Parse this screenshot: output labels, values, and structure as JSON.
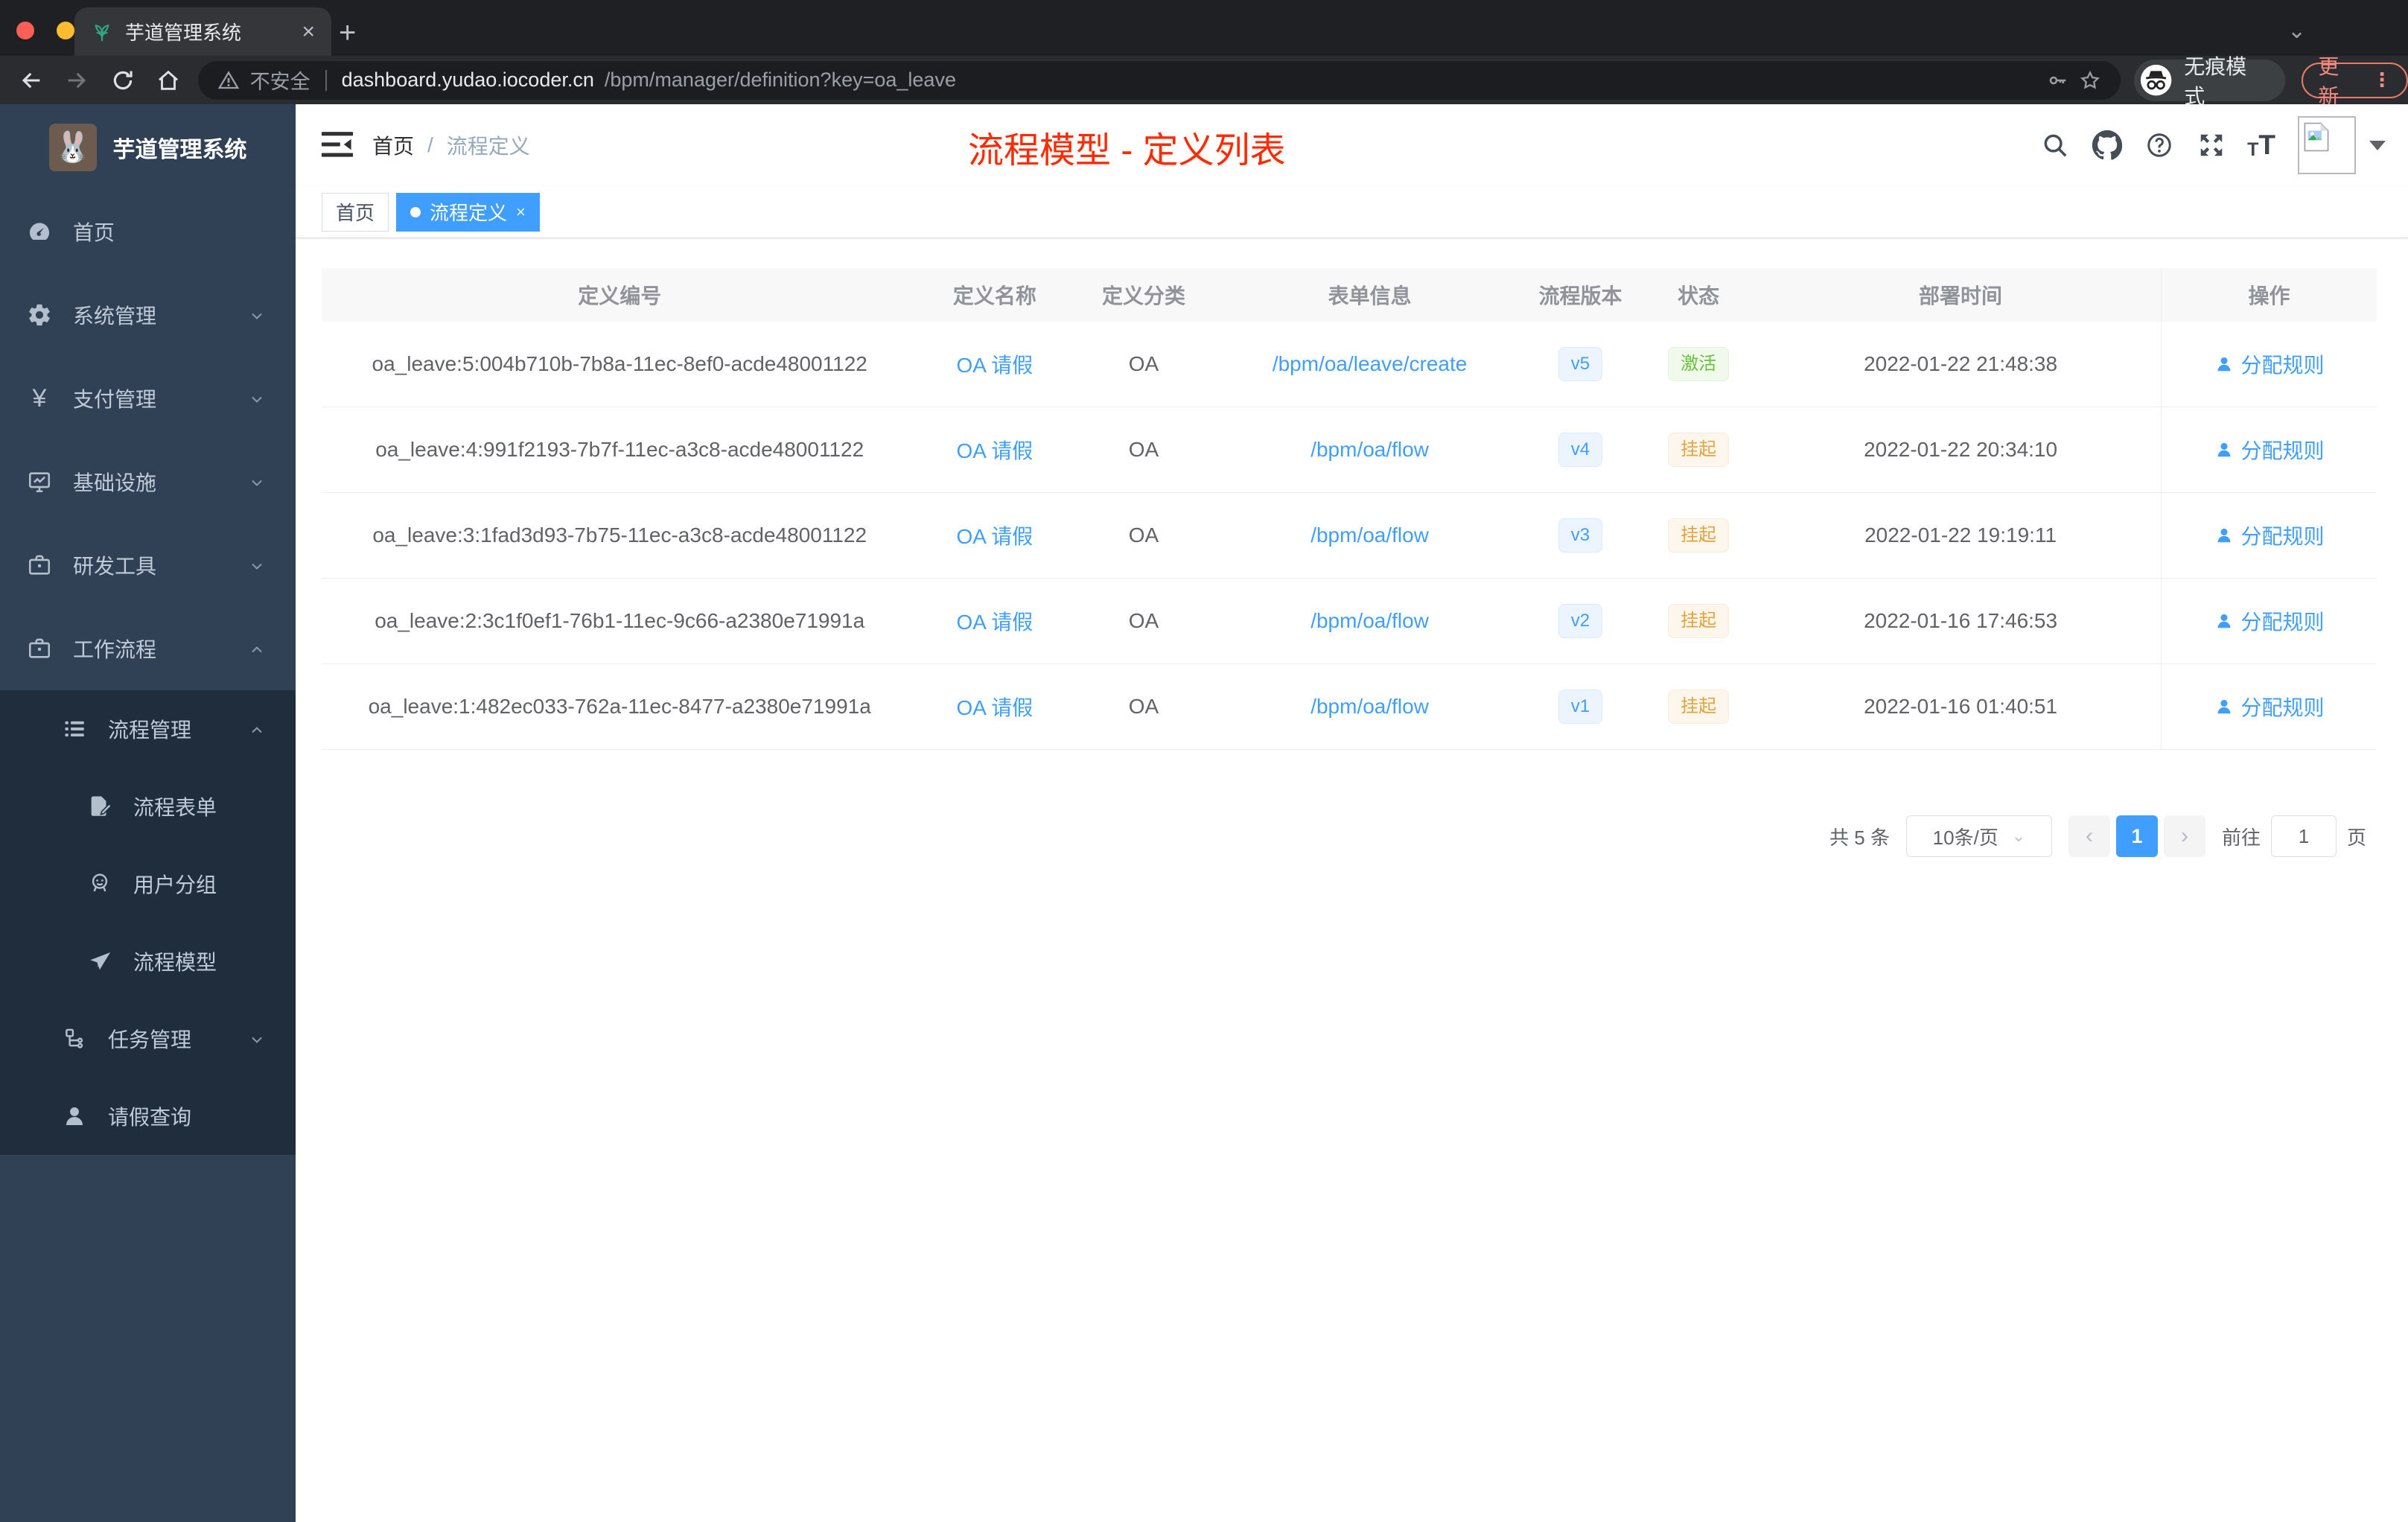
{
  "browser": {
    "tab": {
      "title": "芋道管理系统",
      "close_glyph": "×",
      "new_tab_glyph": "+"
    },
    "address_bar": {
      "security_label": "不安全",
      "url_domain": "dashboard.yudao.iocoder.cn",
      "url_path": "/bpm/manager/definition?key=oa_leave"
    },
    "incognito_label": "无痕模式",
    "update_button": "更新",
    "menu_dots": "⋮"
  },
  "sidebar": {
    "app_title": "芋道管理系统",
    "items": [
      {
        "label": "首页",
        "icon": "dashboard-icon",
        "level": 1
      },
      {
        "label": "系统管理",
        "icon": "gear-icon",
        "level": 1,
        "chevron": "down"
      },
      {
        "label": "支付管理",
        "icon": "yen-icon",
        "level": 1,
        "chevron": "down"
      },
      {
        "label": "基础设施",
        "icon": "monitor-icon",
        "level": 1,
        "chevron": "down"
      },
      {
        "label": "研发工具",
        "icon": "toolbox-icon",
        "level": 1,
        "chevron": "down"
      },
      {
        "label": "工作流程",
        "icon": "briefcase-icon",
        "level": 1,
        "chevron": "up"
      },
      {
        "label": "流程管理",
        "icon": "list-icon",
        "level": 2,
        "chevron": "up",
        "dark": true
      },
      {
        "label": "流程表单",
        "icon": "form-icon",
        "level": 3,
        "dark": true
      },
      {
        "label": "用户分组",
        "icon": "user-group-icon",
        "level": 3,
        "dark": true
      },
      {
        "label": "流程模型",
        "icon": "paper-plane-icon",
        "level": 3,
        "dark": true
      },
      {
        "label": "任务管理",
        "icon": "flow-icon",
        "level": 2,
        "chevron": "down",
        "dark": true
      },
      {
        "label": "请假查询",
        "icon": "user-icon",
        "level": 2,
        "dark": true
      }
    ]
  },
  "header": {
    "breadcrumb_home": "首页",
    "breadcrumb_separator": "/",
    "breadcrumb_current": "流程定义",
    "annotation": "流程模型 - 定义列表"
  },
  "tags": [
    {
      "label": "首页",
      "active": false,
      "closable": false
    },
    {
      "label": "流程定义",
      "active": true,
      "closable": true
    }
  ],
  "table": {
    "columns": [
      "定义编号",
      "定义名称",
      "定义分类",
      "表单信息",
      "流程版本",
      "状态",
      "部署时间",
      "操作"
    ],
    "rows": [
      {
        "id": "oa_leave:5:004b710b-7b8a-11ec-8ef0-acde48001122",
        "name": "OA 请假",
        "category": "OA",
        "form": "/bpm/oa/leave/create",
        "version": "v5",
        "status": "激活",
        "status_type": "active",
        "deploy_time": "2022-01-22 21:48:38",
        "action": "分配规则"
      },
      {
        "id": "oa_leave:4:991f2193-7b7f-11ec-a3c8-acde48001122",
        "name": "OA 请假",
        "category": "OA",
        "form": "/bpm/oa/flow",
        "version": "v4",
        "status": "挂起",
        "status_type": "suspended",
        "deploy_time": "2022-01-22 20:34:10",
        "action": "分配规则"
      },
      {
        "id": "oa_leave:3:1fad3d93-7b75-11ec-a3c8-acde48001122",
        "name": "OA 请假",
        "category": "OA",
        "form": "/bpm/oa/flow",
        "version": "v3",
        "status": "挂起",
        "status_type": "suspended",
        "deploy_time": "2022-01-22 19:19:11",
        "action": "分配规则"
      },
      {
        "id": "oa_leave:2:3c1f0ef1-76b1-11ec-9c66-a2380e71991a",
        "name": "OA 请假",
        "category": "OA",
        "form": "/bpm/oa/flow",
        "version": "v2",
        "status": "挂起",
        "status_type": "suspended",
        "deploy_time": "2022-01-16 17:46:53",
        "action": "分配规则"
      },
      {
        "id": "oa_leave:1:482ec033-762a-11ec-8477-a2380e71991a",
        "name": "OA 请假",
        "category": "OA",
        "form": "/bpm/oa/flow",
        "version": "v1",
        "status": "挂起",
        "status_type": "suspended",
        "deploy_time": "2022-01-16 01:40:51",
        "action": "分配规则"
      }
    ]
  },
  "pagination": {
    "total": "共 5 条",
    "page_size": "10条/页",
    "prev_glyph": "‹",
    "next_glyph": "›",
    "current_page": "1",
    "goto_label": "前往",
    "goto_value": "1",
    "page_unit": "页"
  },
  "colors": {
    "accent": "#409eff",
    "success": "#67c23a",
    "warning": "#e6a23c",
    "annotation_red": "#ff2b00",
    "sidebar_bg": "#304156",
    "submenu_bg": "#1f2d3d",
    "tab_dark": "#35363a"
  }
}
